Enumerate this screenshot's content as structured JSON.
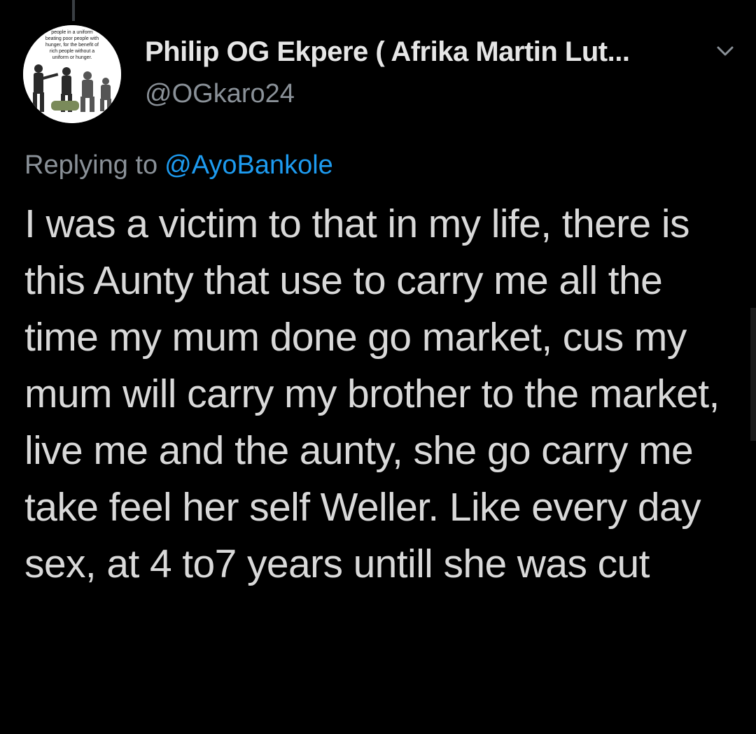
{
  "tweet": {
    "author": {
      "display_name": "Philip OG Ekpere ( Afrika Martin Lut...",
      "handle": "@OGkaro24",
      "avatar_caption": "people in a uniform beating poor people with hunger, for the benefit of rich people without a uniform or hunger."
    },
    "reply": {
      "prefix": "Replying to",
      "to_handle": "@AyoBankole"
    },
    "body": "I was a victim to that in my life, there is this Aunty that use to carry me all the time my mum done go market, cus my mum will carry my brother to the market, live me and the aunty, she go carry me take feel her self Weller. Like every day sex, at 4 to7 years untill she was cut"
  },
  "icons": {
    "menu": "chevron-down-icon"
  },
  "colors": {
    "background": "#000000",
    "text": "#d9d9d9",
    "secondary": "#8a9198",
    "link": "#1d9bf0"
  }
}
